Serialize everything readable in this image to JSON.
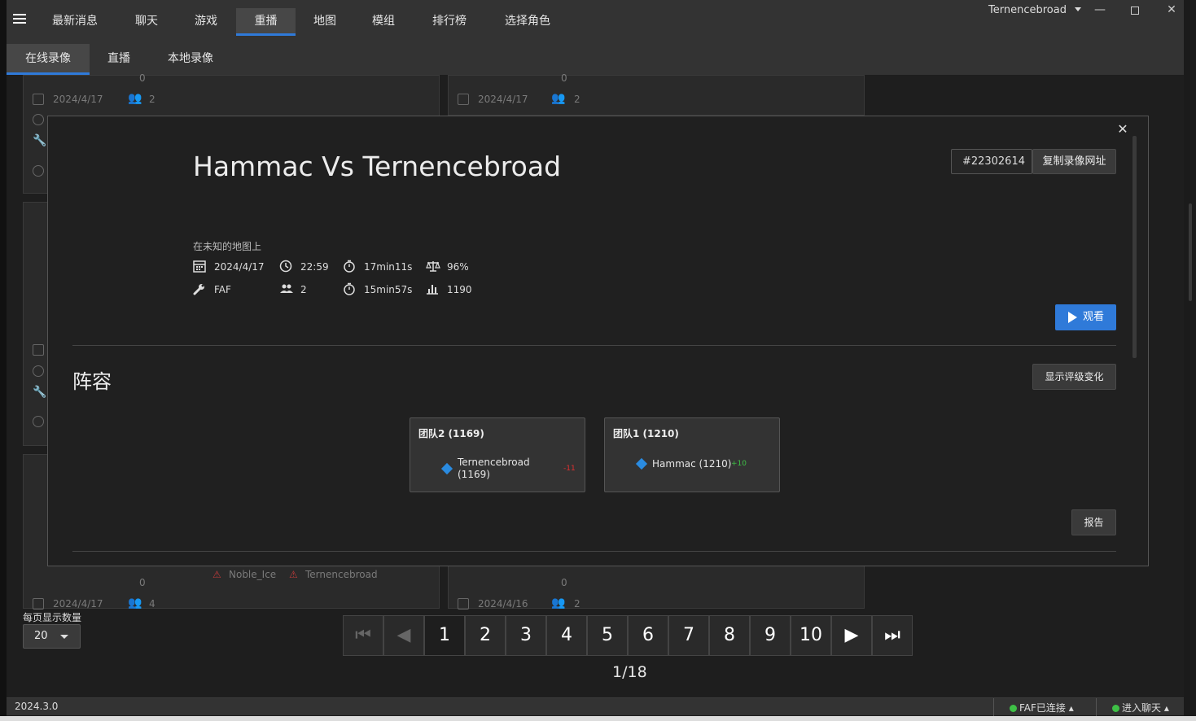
{
  "nav": {
    "tabs": [
      "最新消息",
      "聊天",
      "游戏",
      "重播",
      "地图",
      "模组",
      "排行榜",
      "选择角色"
    ],
    "active_tab": "重播",
    "user": "Ternencebroad"
  },
  "subnav": {
    "tabs": [
      "在线录像",
      "直播",
      "本地录像"
    ],
    "active_tab": "在线录像"
  },
  "background_cards": [
    {
      "date": "2024/4/17",
      "players": "2",
      "rating_count": "0"
    },
    {
      "date": "2024/4/17",
      "players": "2",
      "rating_count": "0"
    },
    {
      "date": "2024/4/17",
      "players": "4",
      "rating_count": "0",
      "player_names": [
        "Noble_Ice",
        "Ternencebroad"
      ]
    },
    {
      "date": "2024/4/16",
      "players": "2",
      "rating_count": "0"
    }
  ],
  "replay": {
    "title": "Hammac Vs Ternencebroad",
    "id": "#22302614",
    "copy_url_label": "复制录像网址",
    "map": "在未知的地图上",
    "date": "2024/4/17",
    "time": "22:59",
    "duration": "17min11s",
    "quality": "96%",
    "featured_mod": "FAF",
    "player_count": "2",
    "duration_2": "15min57s",
    "rating": "1190",
    "watch_label": "观看",
    "lineup_title": "阵容",
    "show_rating_change_label": "显示评级变化",
    "report_label": "报告",
    "teams": [
      {
        "title": "团队2 (1169)",
        "player": "Ternencebroad",
        "player_rating": "(1169)",
        "delta": "-11",
        "delta_color": "#e03030"
      },
      {
        "title": "团队1 (1210)",
        "player": "Hammac (1210)",
        "delta": "+10",
        "delta_color": "#3ec046"
      }
    ]
  },
  "pagination": {
    "per_page_label": "每页显示数量",
    "per_page_value": "20",
    "pages": [
      "1",
      "2",
      "3",
      "4",
      "5",
      "6",
      "7",
      "8",
      "9",
      "10"
    ],
    "page_info": "1/18"
  },
  "status": {
    "version": "2024.3.0",
    "faf_status": "FAF已连接",
    "chat_status": "进入聊天"
  },
  "colors": {
    "accent": "#2f7ad9",
    "online": "#3ec046"
  }
}
